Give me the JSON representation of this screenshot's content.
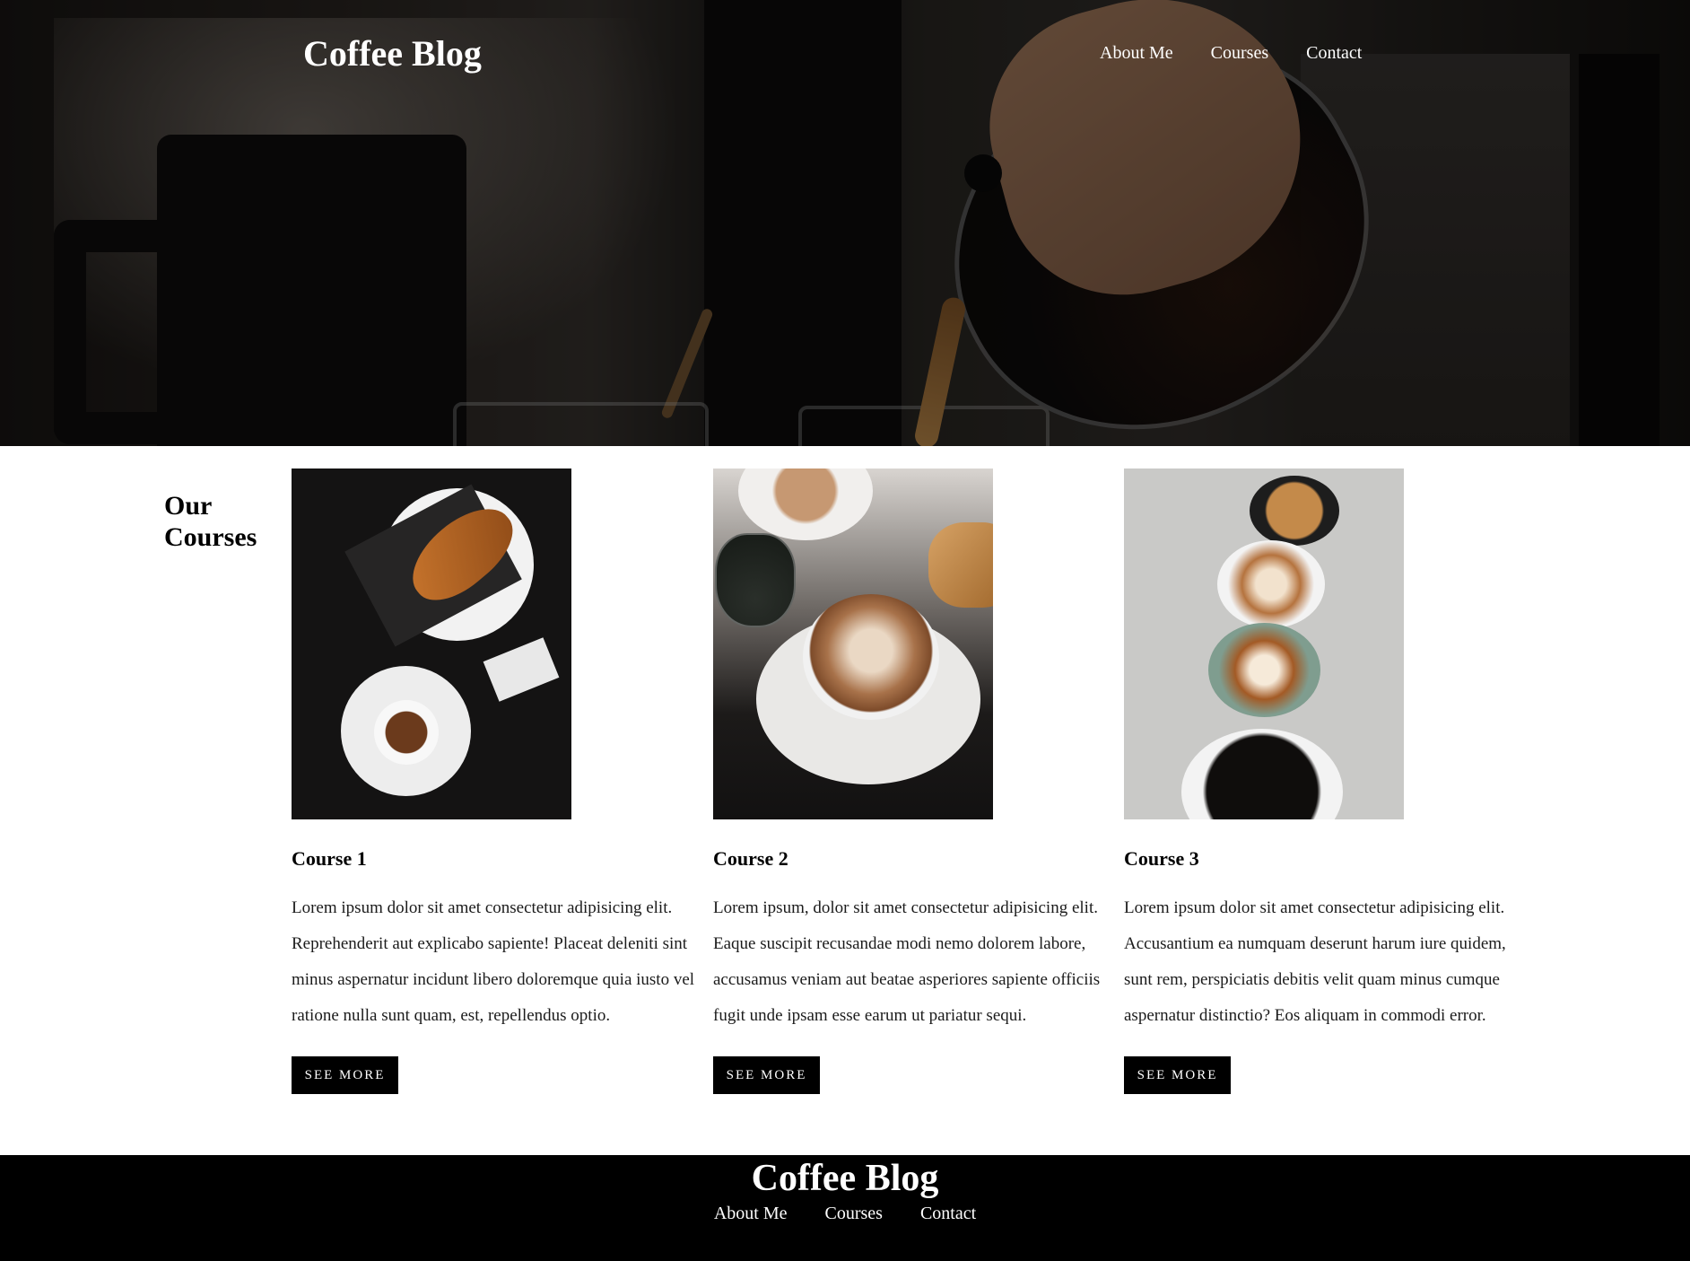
{
  "header": {
    "brand": "Coffee Blog",
    "nav": [
      "About Me",
      "Courses",
      "Contact"
    ]
  },
  "courses_section": {
    "title": "Our Courses",
    "items": [
      {
        "title": "Course 1",
        "text": "Lorem ipsum dolor sit amet consectetur adipisicing elit. Reprehenderit aut explicabo sapiente! Placeat deleniti sint minus aspernatur incidunt libero doloremque quia iusto vel ratione nulla sunt quam, est, repellendus optio.",
        "button": "SEE MORE"
      },
      {
        "title": "Course 2",
        "text": "Lorem ipsum, dolor sit amet consectetur adipisicing elit. Eaque suscipit recusandae modi nemo dolorem labore, accusamus veniam aut beatae asperiores sapiente officiis fugit unde ipsam esse earum ut pariatur sequi.",
        "button": "SEE MORE"
      },
      {
        "title": "Course 3",
        "text": "Lorem ipsum dolor sit amet consectetur adipisicing elit. Accusantium ea numquam deserunt harum iure quidem, sunt rem, perspiciatis debitis velit quam minus cumque aspernatur distinctio? Eos aliquam in commodi error.",
        "button": "SEE MORE"
      }
    ]
  },
  "footer": {
    "brand": "Coffee Blog",
    "nav": [
      "About Me",
      "Courses",
      "Contact"
    ]
  }
}
